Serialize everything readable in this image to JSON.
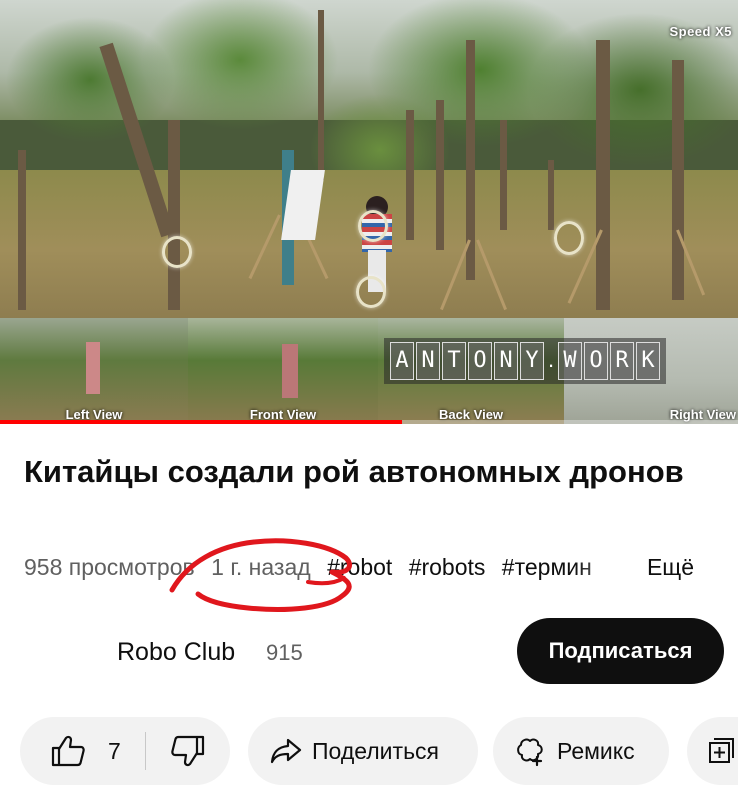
{
  "video": {
    "speed_overlay": "Speed X5",
    "thumbnail_labels": [
      "Left View",
      "Front View",
      "Back View",
      "Right View"
    ],
    "watermark": "ANTONY.WORK",
    "progress_fraction": 0.545
  },
  "title": "Китайцы создали рой автономных дронов",
  "meta": {
    "views": "958 просмотров",
    "age": "1 г. назад",
    "tags": [
      "#robot",
      "#robots",
      "#термин"
    ],
    "more_label": "Ещё"
  },
  "channel": {
    "name": "Robo Club",
    "subscribers": "915",
    "subscribe_label": "Подписаться"
  },
  "actions": {
    "like_count": "7",
    "share_label": "Поделиться",
    "remix_label": "Ремикс"
  },
  "colors": {
    "progress": "#ff0000",
    "subscribe_bg": "#0f0f0f",
    "pill_bg": "#f2f2f2",
    "scribble": "#e0171d"
  }
}
